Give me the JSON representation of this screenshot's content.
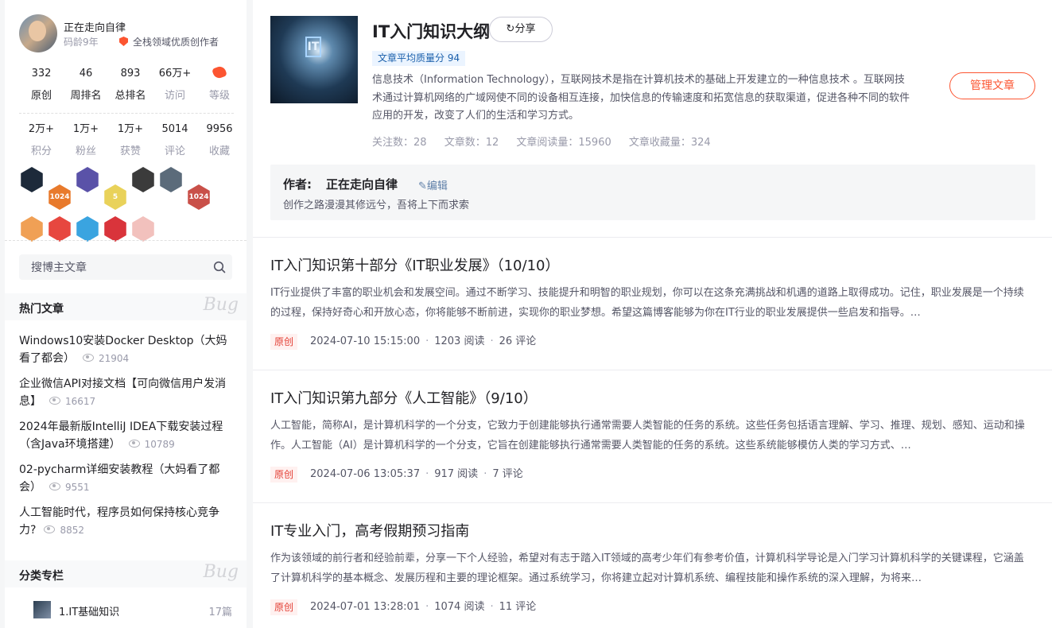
{
  "profile": {
    "name": "正在走向自律",
    "code_age": "码龄9年",
    "creator_title": "全栈领域优质创作者",
    "stats1": [
      {
        "num": "332",
        "label": "原创"
      },
      {
        "num": "46",
        "label": "周排名"
      },
      {
        "num": "893",
        "label": "总排名"
      },
      {
        "num": "66万+",
        "label": "访问"
      },
      {
        "num": "",
        "label": "等级"
      }
    ],
    "stats2": [
      {
        "num": "2万+",
        "label": "积分"
      },
      {
        "num": "1万+",
        "label": "粉丝"
      },
      {
        "num": "1万+",
        "label": "获赞"
      },
      {
        "num": "5014",
        "label": "评论"
      },
      {
        "num": "9956",
        "label": "收藏"
      }
    ],
    "badges": [
      {
        "text": "",
        "color": "#1d2a3a"
      },
      {
        "text": "1024",
        "color": "#e87a2c"
      },
      {
        "text": "",
        "color": "#5a52a8"
      },
      {
        "text": "5",
        "color": "#e9d25a"
      },
      {
        "text": "",
        "color": "#3b3b3b"
      },
      {
        "text": "",
        "color": "#5b6b7a"
      },
      {
        "text": "1024",
        "color": "#c95049"
      },
      {
        "text": "",
        "color": "#f0a055"
      },
      {
        "text": "",
        "color": "#e7473f"
      },
      {
        "text": "",
        "color": "#3aa4e0"
      },
      {
        "text": "",
        "color": "#d9343b"
      },
      {
        "text": "",
        "color": "#f2c1bd"
      }
    ]
  },
  "search": {
    "placeholder": "搜博主文章"
  },
  "hot_section": {
    "title": "热门文章",
    "deco": "Bug"
  },
  "hot_articles": [
    {
      "title": "Windows10安装Docker Desktop（大妈看了都会）",
      "views": "21904"
    },
    {
      "title": "企业微信API对接文档【可向微信用户发消息】",
      "views": "16617"
    },
    {
      "title": "2024年最新版IntelliJ IDEA下载安装过程（含Java环境搭建）",
      "views": "10789"
    },
    {
      "title": "02-pycharm详细安装教程（大妈看了都会）",
      "views": "9551"
    },
    {
      "title": "人工智能时代，程序员如何保持核心竞争力?",
      "views": "8852"
    }
  ],
  "column_section": {
    "title": "分类专栏",
    "deco": "Bug"
  },
  "columns": [
    {
      "name": "1.IT基础知识",
      "count": "17篇"
    }
  ],
  "column_header": {
    "title": "IT入门知识大纲",
    "share_label": "分享",
    "quality": "文章平均质量分 94",
    "description": "信息技术（Information Technology），互联网技术是指在计算机技术的基础上开发建立的一种信息技术 。互联网技术通过计算机网络的广域网使不同的设备相互连接，加快信息的传输速度和拓宽信息的获取渠道，促进各种不同的软件应用的开发，改变了人们的生活和学习方式。",
    "meta": [
      "关注数：28",
      "文章数：12",
      "文章阅读量：15960",
      "文章收藏量：324"
    ],
    "manage_label": "管理文章"
  },
  "author": {
    "label": "作者:",
    "name": "正在走向自律",
    "edit_label": "编辑",
    "motto": "创作之路漫漫其修远兮，吾将上下而求索"
  },
  "articles": [
    {
      "title": "IT入门知识第十部分《IT职业发展》（10/10）",
      "summary": "IT行业提供了丰富的职业机会和发展空间。通过不断学习、技能提升和明智的职业规划，你可以在这条充满挑战和机遇的道路上取得成功。记住，职业发展是一个持续的过程，保持好奇心和开放心态，你将能够不断前进，实现你的职业梦想。希望这篇博客能够为你在IT行业的职业发展提供一些启发和指导。…",
      "tag": "原创",
      "date": "2024-07-10 15:15:00",
      "reads": "1203 阅读",
      "comments": "26 评论"
    },
    {
      "title": "IT入门知识第九部分《人工智能》（9/10）",
      "summary": "人工智能，简称AI，是计算机科学的一个分支，它致力于创建能够执行通常需要人类智能的任务的系统。这些任务包括语言理解、学习、推理、规划、感知、运动和操作。人工智能（AI）是计算机科学的一个分支，它旨在创建能够执行通常需要人类智能的任务的系统。这些系统能够模仿人类的学习方式、…",
      "tag": "原创",
      "date": "2024-07-06 13:05:37",
      "reads": "917 阅读",
      "comments": "7 评论"
    },
    {
      "title": "IT专业入门，高考假期预习指南",
      "summary": "作为该领域的前行者和经验前辈，分享一下个人经验，希望对有志于踏入IT领域的高考少年们有参考价值，计算机科学导论是入门学习计算机科学的关键课程，它涵盖了计算机科学的基本概念、发展历程和主要的理论框架。通过系统学习，你将建立起对计算机系统、编程技能和操作系统的深入理解，为将来…",
      "tag": "原创",
      "date": "2024-07-01 13:28:01",
      "reads": "1074 阅读",
      "comments": "11 评论"
    }
  ],
  "colors": {
    "accent": "#fc5531",
    "link": "#5e7fa8",
    "quality_bg": "#ebf4ff"
  }
}
